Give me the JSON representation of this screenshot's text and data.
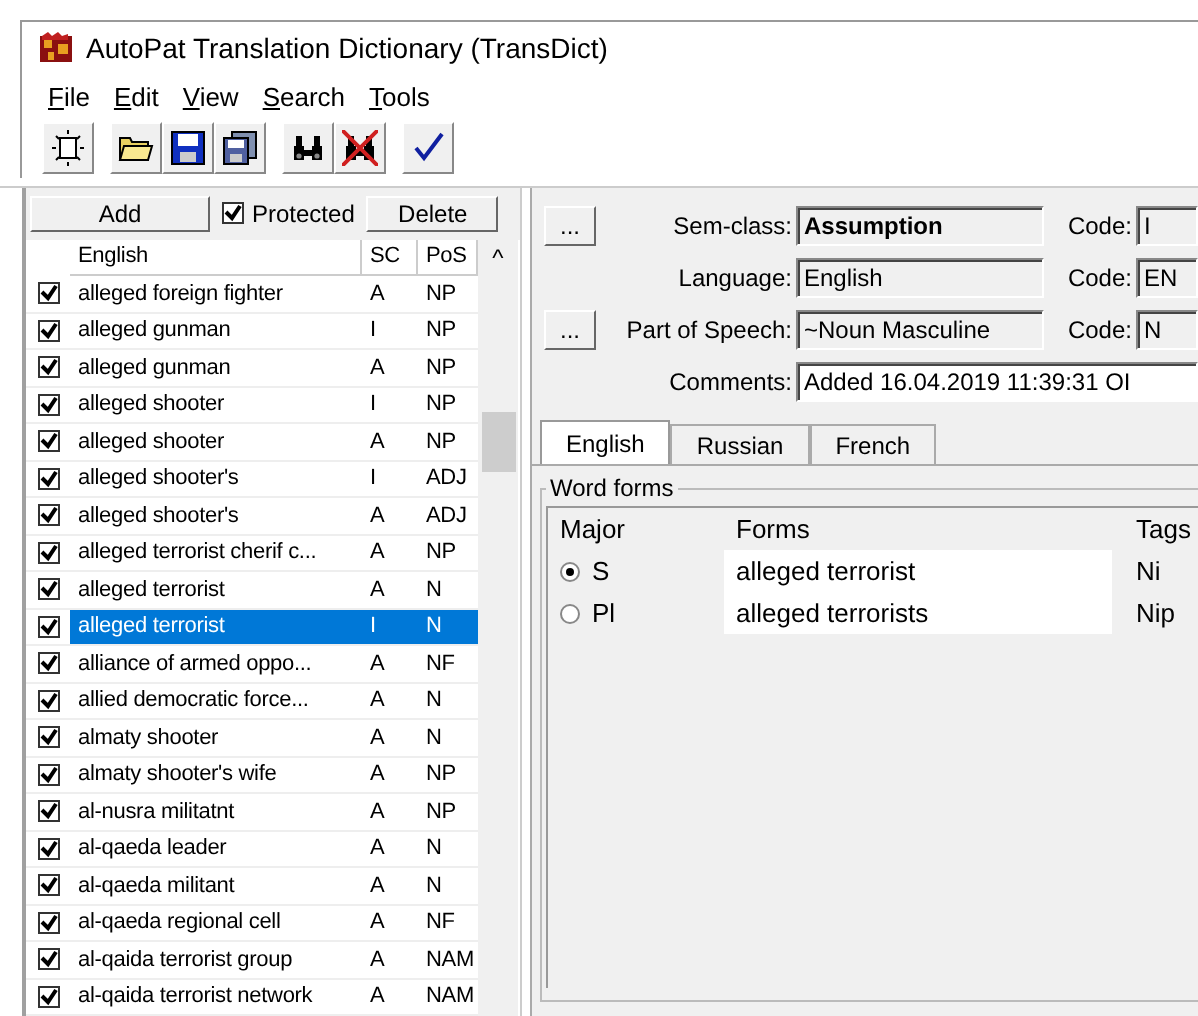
{
  "window": {
    "title": "AutoPat Translation Dictionary (TransDict)"
  },
  "menu": [
    "File",
    "Edit",
    "View",
    "Search",
    "Tools"
  ],
  "list_toolbar": {
    "add": "Add",
    "protected": {
      "label": "Protected",
      "checked": true
    },
    "delete": "Delete"
  },
  "list": {
    "columns": [
      "English",
      "SC",
      "PoS"
    ],
    "sort_arrow": "^",
    "rows": [
      {
        "english": "alleged foreign fighter",
        "sc": "A",
        "pos": "NP",
        "checked": true,
        "selected": false
      },
      {
        "english": "alleged gunman",
        "sc": "I",
        "pos": "NP",
        "checked": true,
        "selected": false
      },
      {
        "english": "alleged gunman",
        "sc": "A",
        "pos": "NP",
        "checked": true,
        "selected": false
      },
      {
        "english": "alleged shooter",
        "sc": "I",
        "pos": "NP",
        "checked": true,
        "selected": false
      },
      {
        "english": "alleged shooter",
        "sc": "A",
        "pos": "NP",
        "checked": true,
        "selected": false
      },
      {
        "english": "alleged shooter's",
        "sc": "I",
        "pos": "ADJ",
        "checked": true,
        "selected": false
      },
      {
        "english": "alleged shooter's",
        "sc": "A",
        "pos": "ADJ",
        "checked": true,
        "selected": false
      },
      {
        "english": "alleged terrorist cherif c...",
        "sc": "A",
        "pos": "NP",
        "checked": true,
        "selected": false
      },
      {
        "english": "alleged terrorist",
        "sc": "A",
        "pos": "N",
        "checked": true,
        "selected": false
      },
      {
        "english": "alleged terrorist",
        "sc": "I",
        "pos": "N",
        "checked": true,
        "selected": true
      },
      {
        "english": "alliance of armed oppo...",
        "sc": "A",
        "pos": "NF",
        "checked": true,
        "selected": false
      },
      {
        "english": "allied democratic force...",
        "sc": "A",
        "pos": "N",
        "checked": true,
        "selected": false
      },
      {
        "english": "almaty shooter",
        "sc": "A",
        "pos": "N",
        "checked": true,
        "selected": false
      },
      {
        "english": "almaty shooter's wife",
        "sc": "A",
        "pos": "NP",
        "checked": true,
        "selected": false
      },
      {
        "english": "al-nusra militatnt",
        "sc": "A",
        "pos": "NP",
        "checked": true,
        "selected": false
      },
      {
        "english": "al-qaeda leader",
        "sc": "A",
        "pos": "N",
        "checked": true,
        "selected": false
      },
      {
        "english": "al-qaeda militant",
        "sc": "A",
        "pos": "N",
        "checked": true,
        "selected": false
      },
      {
        "english": "al-qaeda regional cell",
        "sc": "A",
        "pos": "NF",
        "checked": true,
        "selected": false
      },
      {
        "english": "al-qaida terrorist group",
        "sc": "A",
        "pos": "NAM",
        "checked": true,
        "selected": false
      },
      {
        "english": "al-qaida terrorist network",
        "sc": "A",
        "pos": "NAM",
        "checked": true,
        "selected": false
      }
    ]
  },
  "details": {
    "fields": [
      {
        "button": "...",
        "label": "Sem-class:",
        "value": "Assumption",
        "code_label": "Code:",
        "code": "I",
        "kind": "bold"
      },
      {
        "label": "Language:",
        "value": "English",
        "code_label": "Code:",
        "code": "EN",
        "kind": "plain"
      },
      {
        "button": "...",
        "label": "Part of Speech:",
        "value": "~Noun Masculine",
        "code_label": "Code:",
        "code": "N",
        "kind": "plain"
      },
      {
        "label": "Comments:",
        "value": "Added 16.04.2019  11:39:31  OI",
        "kind": "wide"
      }
    ],
    "tabs": [
      {
        "label": "English",
        "selected": true
      },
      {
        "label": "Russian",
        "selected": false
      },
      {
        "label": "French",
        "selected": false
      }
    ],
    "word_forms": {
      "title": "Word forms",
      "columns": [
        "Major",
        "Forms",
        "Tags"
      ],
      "rows": [
        {
          "major": "S",
          "form": "alleged terrorist",
          "tags": "Ni",
          "selected": true
        },
        {
          "major": "Pl",
          "form": "alleged terrorists",
          "tags": "Nip",
          "selected": false
        }
      ]
    }
  }
}
